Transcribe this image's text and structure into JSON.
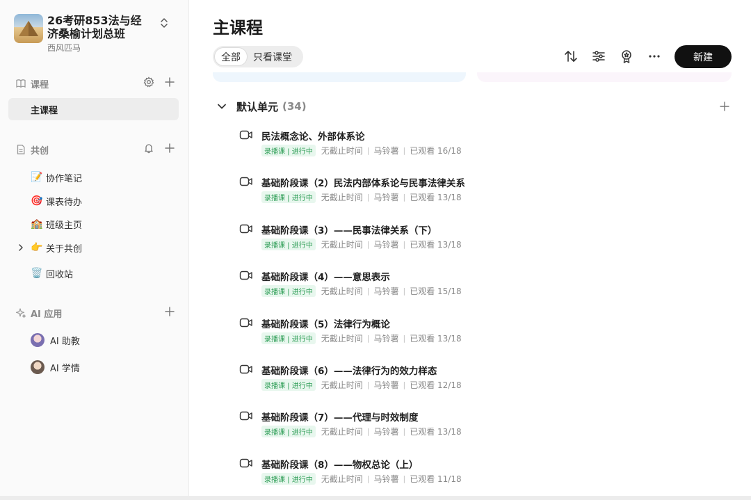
{
  "sidebar": {
    "class_title": "26考研853法与经济桑榆计划总班",
    "class_subtitle": "西风匹马",
    "courses_section": {
      "label": "课程",
      "active_item": "主课程"
    },
    "cocreate_section": {
      "label": "共创",
      "items": [
        {
          "emoji": "📝",
          "label": "协作笔记"
        },
        {
          "emoji": "🎯",
          "label": "课表待办"
        },
        {
          "emoji": "🏫",
          "label": "班级主页"
        },
        {
          "emoji": "👉",
          "label": "关于共创"
        },
        {
          "emoji": "🗑️",
          "label": "回收站"
        }
      ]
    },
    "ai_section": {
      "label": "AI 应用",
      "items": [
        {
          "label": "AI 助教"
        },
        {
          "label": "AI 学情"
        }
      ]
    }
  },
  "main": {
    "title": "主课程",
    "filters": [
      "全部",
      "只看课堂"
    ],
    "new_button": "新建",
    "unit": {
      "title": "默认单元",
      "count": "(34)"
    },
    "lessons": [
      {
        "title": "民法概念论、外部体系论",
        "badge": "录播课 | 进行中",
        "deadline": "无截止时间",
        "teacher": "马铃薯",
        "progress": "已观看 16/18"
      },
      {
        "title": "基础阶段课（2）民法内部体系论与民事法律关系",
        "badge": "录播课 | 进行中",
        "deadline": "无截止时间",
        "teacher": "马铃薯",
        "progress": "已观看 13/18"
      },
      {
        "title": "基础阶段课（3）——民事法律关系（下）",
        "badge": "录播课 | 进行中",
        "deadline": "无截止时间",
        "teacher": "马铃薯",
        "progress": "已观看 13/18"
      },
      {
        "title": "基础阶段课（4）——意思表示",
        "badge": "录播课 | 进行中",
        "deadline": "无截止时间",
        "teacher": "马铃薯",
        "progress": "已观看 15/18"
      },
      {
        "title": "基础阶段课（5）法律行为概论",
        "badge": "录播课 | 进行中",
        "deadline": "无截止时间",
        "teacher": "马铃薯",
        "progress": "已观看 13/18"
      },
      {
        "title": "基础阶段课（6）——法律行为的效力样态",
        "badge": "录播课 | 进行中",
        "deadline": "无截止时间",
        "teacher": "马铃薯",
        "progress": "已观看 12/18"
      },
      {
        "title": "基础阶段课（7）——代理与时效制度",
        "badge": "录播课 | 进行中",
        "deadline": "无截止时间",
        "teacher": "马铃薯",
        "progress": "已观看 13/18"
      },
      {
        "title": "基础阶段课（8）——物权总论（上）",
        "badge": "录播课 | 进行中",
        "deadline": "无截止时间",
        "teacher": "马铃薯",
        "progress": "已观看 11/18"
      }
    ]
  }
}
